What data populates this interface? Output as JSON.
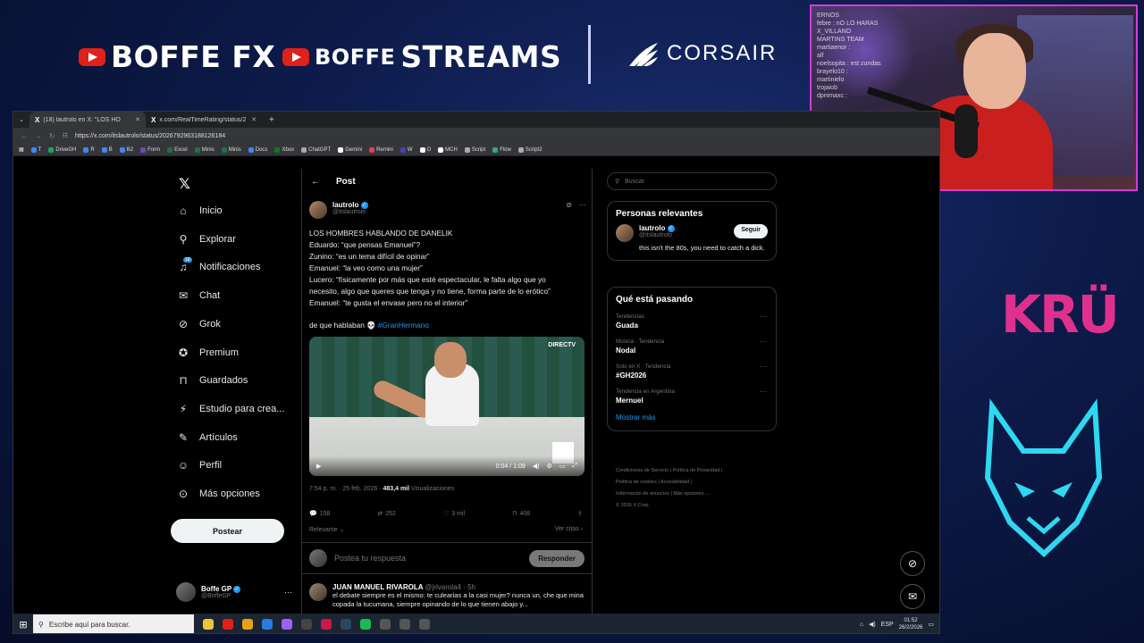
{
  "overlay": {
    "brand1": "BOFFE FX",
    "brand2_small": "BOFFE",
    "brand2_big": "STREAMS",
    "sponsor": "CORSAIR",
    "side_logo": "KRÜ",
    "webcam_chat": "ERNOS\nfebre : nO LO HARAS\nX_VILLANO\nMARTINS TEAM\nmartiaenor :\nalf\nnoelsopita : est zundas\nbrayelo10 :\nmartinielo\ntrojaiob\ndpnimaxc :"
  },
  "browser": {
    "tabs": [
      {
        "title": "(18) lautrolo en X: \"LOS HO",
        "active": true
      },
      {
        "title": "x.com/RealTimeRating/status/2",
        "active": false
      }
    ],
    "url": "https://x.com/itslautrolo/status/2026792963188126184",
    "bookmarks": [
      {
        "label": "T",
        "color": "#4285f4"
      },
      {
        "label": "DriveGH",
        "color": "#1fa463"
      },
      {
        "label": "R",
        "color": "#4285f4"
      },
      {
        "label": "B",
        "color": "#4285f4"
      },
      {
        "label": "B2",
        "color": "#4285f4"
      },
      {
        "label": "Form",
        "color": "#7248b9"
      },
      {
        "label": "Excel",
        "color": "#1e7145"
      },
      {
        "label": "Minis",
        "color": "#1e7145"
      },
      {
        "label": "Minis",
        "color": "#1e7145"
      },
      {
        "label": "Docs",
        "color": "#4285f4"
      },
      {
        "label": "Xbox",
        "color": "#107c10"
      },
      {
        "label": "ChatGPT",
        "color": "#aaaaaa"
      },
      {
        "label": "Gemini",
        "color": "#ffffff"
      },
      {
        "label": "Remini",
        "color": "#e83e5a"
      },
      {
        "label": "W",
        "color": "#4b3fbd"
      },
      {
        "label": "O",
        "color": "#ffffff"
      },
      {
        "label": "MCH",
        "color": "#ffffff"
      },
      {
        "label": "Script",
        "color": "#aaaaaa"
      },
      {
        "label": "Flow",
        "color": "#33aa77"
      },
      {
        "label": "Script2",
        "color": "#aaaaaa"
      }
    ]
  },
  "nav": {
    "items": [
      {
        "label": "Inicio",
        "icon": "home-icon",
        "glyph": "⌂"
      },
      {
        "label": "Explorar",
        "icon": "search-icon",
        "glyph": "⚲"
      },
      {
        "label": "Notificaciones",
        "icon": "bell-icon",
        "glyph": "♫"
      },
      {
        "label": "Chat",
        "icon": "mail-icon",
        "glyph": "✉"
      },
      {
        "label": "Grok",
        "icon": "grok-icon",
        "glyph": "⊘"
      },
      {
        "label": "Premium",
        "icon": "premium-icon",
        "glyph": "✪"
      },
      {
        "label": "Guardados",
        "icon": "bookmark-icon",
        "glyph": "⊓"
      },
      {
        "label": "Estudio para crea...",
        "icon": "studio-icon",
        "glyph": "⚡"
      },
      {
        "label": "Artículos",
        "icon": "article-icon",
        "glyph": "✎"
      },
      {
        "label": "Perfil",
        "icon": "profile-icon",
        "glyph": "☺"
      },
      {
        "label": "Más opciones",
        "icon": "more-icon",
        "glyph": "⊙"
      }
    ],
    "badge": "18",
    "post_button": "Postear",
    "profile_name": "Boffe GP",
    "profile_handle": "@BoffeGP"
  },
  "post": {
    "header": "Post",
    "author_name": "lautrolo",
    "author_handle": "@itslautrolo",
    "lines": [
      "LOS HOMBRES HABLANDO DE DANELIK",
      "Eduardo: “que pensas Emanuel”?",
      "Zunino: “es un tema difícil de opinar”",
      "Emanuel: “la veo como una mujer”",
      "Lucero: “físicamente por más que esté espectacular, le falta algo que yo",
      "necesito, algo que queres que tenga y no tiene, forma parte de lo erótico”",
      "Emanuel: “te gusta el envase pero no el interior”"
    ],
    "extra_text": "de que hablaban 💀 ",
    "hashtag": "#GranHermano",
    "media_logo": "DIRECTV",
    "media_time": "0:04 / 1:09",
    "time": "7:54 p. m. · 25 feb. 2026 · ",
    "views": "483,4 mil",
    "views_label": " Visualizaciones",
    "replies": "158",
    "reposts": "252",
    "likes": "3 mil",
    "bookmarks": "408",
    "sort": "Relevante",
    "quotes": "Ver citas",
    "reply_placeholder": "Postea tu respuesta",
    "reply_button": "Responder",
    "comment_name": "JUAN MANUEL RIVAROLA",
    "comment_handle": "@jrivarola4 · 5h",
    "comment_text": "el debate siempre es el mismo: te culearias a la casi mujer? nunca un, che que mina copada la tucumana, siempre opinando de lo que tienen abajo y..."
  },
  "sidebar": {
    "search_placeholder": "Buscar",
    "relevant_title": "Personas relevantes",
    "rel_name": "lautrolo",
    "rel_handle": "@itslautrolo",
    "follow": "Seguir",
    "rel_bio": "this isn't the 80s, you need to catch a dick.",
    "trends_title": "Qué está pasando",
    "trends": [
      {
        "meta": "Tendencias",
        "name": "Guada"
      },
      {
        "meta": "Música · Tendencia",
        "name": "Nodal"
      },
      {
        "meta": "Solo en X · Tendencia",
        "name": "#GH2026"
      },
      {
        "meta": "Tendencia en Argentina",
        "name": "Mernuel"
      }
    ],
    "show_more": "Mostrar más",
    "footer": [
      "Condiciones de Servicio  |  Política de Privacidad  |",
      "Política de cookies  |  Accesibilidad  |",
      "Información de anuncios  |  Más opciones ...",
      "© 2026 X Corp."
    ]
  },
  "taskbar": {
    "search": "Escribe aquí para buscar.",
    "lang": "ESP",
    "time": "01:52",
    "date": "26/2/2026"
  }
}
